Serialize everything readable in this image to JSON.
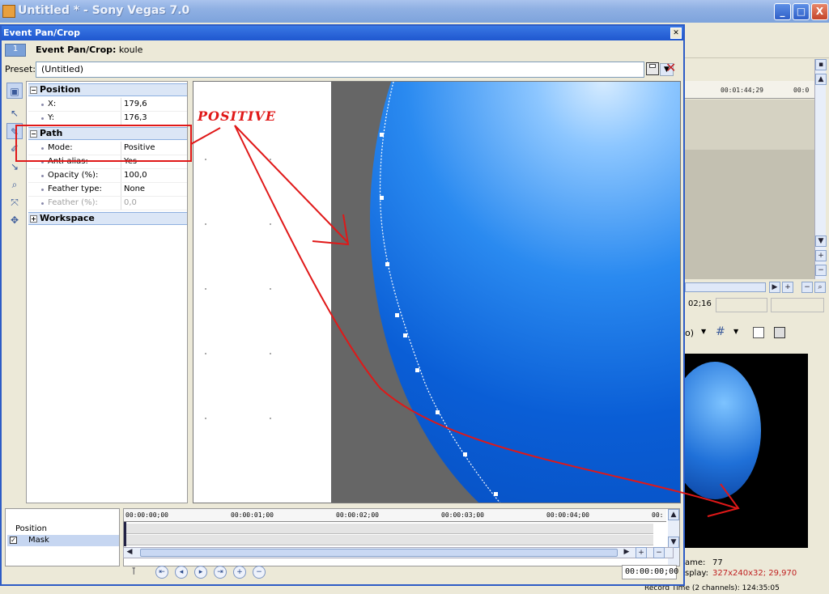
{
  "app": {
    "title": "Untitled * - Sony Vegas 7.0",
    "min": "_",
    "max": "□",
    "close": "X"
  },
  "dialog": {
    "title": "Event Pan/Crop",
    "tab_num": "1",
    "event_prefix": "Event Pan/Crop:",
    "event_name": " koule",
    "preset_label": "Preset:",
    "preset_value": "(Untitled)"
  },
  "props": {
    "position": {
      "label": "Position",
      "x_label": "X:",
      "x_val": "179,6",
      "y_label": "Y:",
      "y_val": "176,3"
    },
    "path": {
      "label": "Path",
      "mode_label": "Mode:",
      "mode_val": "Positive",
      "anti_label": "Anti-alias:",
      "anti_val": "Yes",
      "opacity_label": "Opacity (%):",
      "opacity_val": "100,0",
      "ftype_label": "Feather type:",
      "ftype_val": "None",
      "feather_label": "Feather (%):",
      "feather_val": "0,0"
    },
    "workspace": {
      "label": "Workspace"
    }
  },
  "keyframer": {
    "tracks": [
      "Position",
      "Mask"
    ],
    "ruler": [
      "00:00:00;00",
      "00:00:01;00",
      "00:00:02;00",
      "00:00:03;00",
      "00:00:04;00",
      "00:"
    ],
    "time": "00:00:00;00"
  },
  "bg": {
    "ruler": [
      "00:01:44;29",
      "00:0"
    ],
    "time_frag": "02;16",
    "frame_label": "ame:",
    "frame_val": "77",
    "display_label": "splay:",
    "display_val": "327x240x32; 29,970",
    "record": "Record Time (2 channels): 124:35:05"
  },
  "annotation": {
    "text": "POSITIVE",
    "color": "#e01818"
  },
  "colors": {
    "title_blue": "#1f57cf",
    "accent": "#2a8af0"
  }
}
